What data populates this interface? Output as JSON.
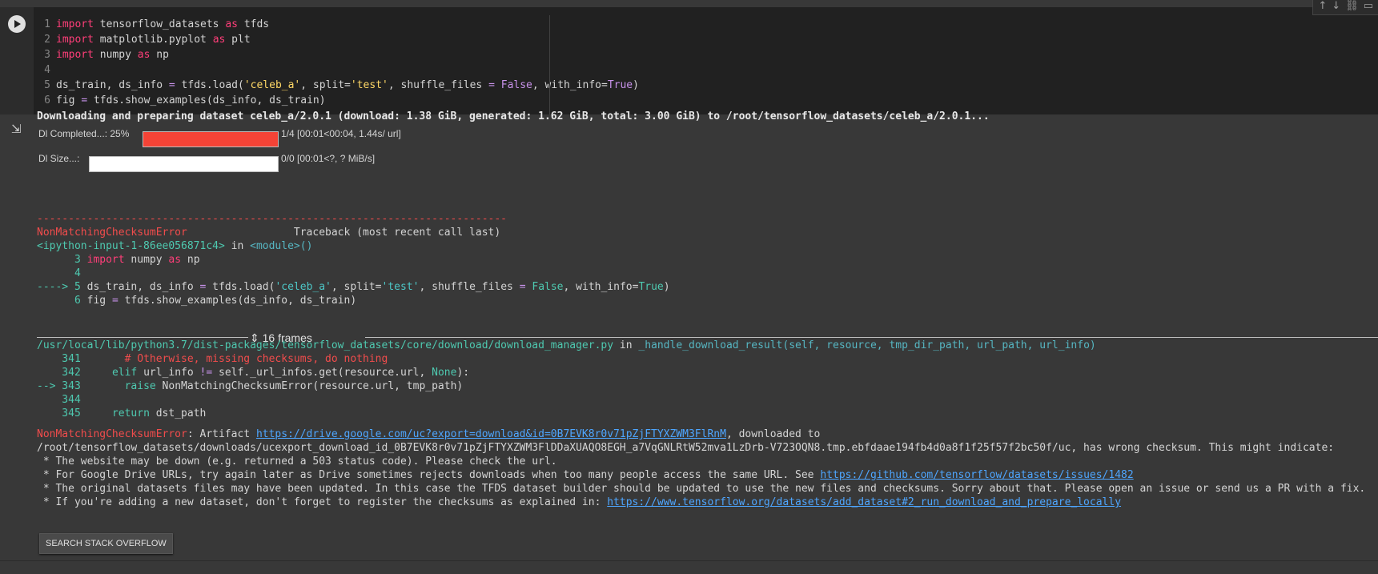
{
  "toolbar": {
    "icons": [
      "arrow-up-icon",
      "arrow-down-icon",
      "link-icon",
      "comment-icon"
    ]
  },
  "code": {
    "lines": [
      {
        "n": "1",
        "parts": [
          {
            "t": "import",
            "c": "kw"
          },
          {
            "t": " tensorflow_datasets ",
            "c": ""
          },
          {
            "t": "as",
            "c": "kw"
          },
          {
            "t": " tfds",
            "c": ""
          }
        ]
      },
      {
        "n": "2",
        "parts": [
          {
            "t": "import",
            "c": "kw"
          },
          {
            "t": " matplotlib.pyplot ",
            "c": ""
          },
          {
            "t": "as",
            "c": "kw"
          },
          {
            "t": " plt",
            "c": ""
          }
        ]
      },
      {
        "n": "3",
        "parts": [
          {
            "t": "import",
            "c": "kw"
          },
          {
            "t": " numpy ",
            "c": ""
          },
          {
            "t": "as",
            "c": "kw"
          },
          {
            "t": " np",
            "c": ""
          }
        ]
      },
      {
        "n": "4",
        "parts": []
      },
      {
        "n": "5",
        "parts": [
          {
            "t": "ds_train, ds_info ",
            "c": ""
          },
          {
            "t": "=",
            "c": "op"
          },
          {
            "t": " tfds.load(",
            "c": ""
          },
          {
            "t": "'celeb_a'",
            "c": "str"
          },
          {
            "t": ", split=",
            "c": ""
          },
          {
            "t": "'test'",
            "c": "str"
          },
          {
            "t": ", shuffle_files ",
            "c": ""
          },
          {
            "t": "=",
            "c": "op"
          },
          {
            "t": " ",
            "c": ""
          },
          {
            "t": "False",
            "c": "bool"
          },
          {
            "t": ", with_info=",
            "c": ""
          },
          {
            "t": "True",
            "c": "bool"
          },
          {
            "t": ")",
            "c": ""
          }
        ]
      },
      {
        "n": "6",
        "parts": [
          {
            "t": "fig ",
            "c": ""
          },
          {
            "t": "=",
            "c": "op"
          },
          {
            "t": " tfds.show_examples(ds_info, ds_train)",
            "c": ""
          }
        ]
      }
    ]
  },
  "output": {
    "header": "Downloading and preparing dataset celeb_a/2.0.1 (download: 1.38 GiB, generated: 1.62 GiB, total: 3.00 GiB) to /root/tensorflow_datasets/celeb_a/2.0.1...",
    "dl_completed": {
      "label": "Dl Completed...: 25%",
      "progress": 1.0,
      "status": "1/4 [00:01<00:04,  1.44s/ url]"
    },
    "dl_size": {
      "label": "Dl Size...:",
      "progress": 0.0,
      "status": "0/0 [00:01<?, ? MiB/s]"
    },
    "dashes": "---------------------------------------------------------------------------",
    "error_name": "NonMatchingChecksumError",
    "traceback_label": "                 Traceback (most recent call last)",
    "ipython_input": "<ipython-input-1-86ee056871c4>",
    "in_word": " in ",
    "module": "<module>()",
    "tb1": [
      {
        "prefix": "      3 ",
        "parts": [
          {
            "t": "import",
            "c": "kw"
          },
          {
            "t": " numpy ",
            "c": ""
          },
          {
            "t": "as",
            "c": "kw"
          },
          {
            "t": " np",
            "c": ""
          }
        ]
      },
      {
        "prefix": "      4 ",
        "parts": []
      },
      {
        "prefix": "----> 5 ",
        "arrow": true,
        "parts": [
          {
            "t": "ds_train, ds_info ",
            "c": ""
          },
          {
            "t": "=",
            "c": "op"
          },
          {
            "t": " tfds.load(",
            "c": ""
          },
          {
            "t": "'celeb_a'",
            "c": "teal"
          },
          {
            "t": ", split=",
            "c": ""
          },
          {
            "t": "'test'",
            "c": "teal"
          },
          {
            "t": ", shuffle_files ",
            "c": ""
          },
          {
            "t": "=",
            "c": "op"
          },
          {
            "t": " ",
            "c": ""
          },
          {
            "t": "False",
            "c": "green"
          },
          {
            "t": ", with_info=",
            "c": ""
          },
          {
            "t": "True",
            "c": "green"
          },
          {
            "t": ")",
            "c": ""
          }
        ]
      },
      {
        "prefix": "      6 ",
        "parts": [
          {
            "t": "fig ",
            "c": ""
          },
          {
            "t": "=",
            "c": "op"
          },
          {
            "t": " tfds.show_examples(ds_info, ds_train)",
            "c": ""
          }
        ]
      }
    ],
    "frames": "16 frames",
    "file_path": "/usr/local/lib/python3.7/dist-packages/tensorflow_datasets/core/download/download_manager.py",
    "func": "_handle_download_result(self, resource, tmp_dir_path, url_path, url_info)",
    "tb2": [
      {
        "prefix": "    341 ",
        "parts": [
          {
            "t": "      # Otherwise, missing checksums, do nothing",
            "c": "red"
          }
        ]
      },
      {
        "prefix": "    342 ",
        "parts": [
          {
            "t": "    ",
            "c": ""
          },
          {
            "t": "elif",
            "c": "green"
          },
          {
            "t": " url_info ",
            "c": ""
          },
          {
            "t": "!=",
            "c": "op"
          },
          {
            "t": " self._url_infos.get(resource.url, ",
            "c": ""
          },
          {
            "t": "None",
            "c": "green"
          },
          {
            "t": "):",
            "c": ""
          }
        ]
      },
      {
        "prefix": "--> 343 ",
        "arrow": true,
        "parts": [
          {
            "t": "      ",
            "c": ""
          },
          {
            "t": "raise",
            "c": "green"
          },
          {
            "t": " NonMatchingChecksumError(resource.url, tmp_path)",
            "c": ""
          }
        ]
      },
      {
        "prefix": "    344 ",
        "parts": []
      },
      {
        "prefix": "    345 ",
        "parts": [
          {
            "t": "    ",
            "c": ""
          },
          {
            "t": "return",
            "c": "green"
          },
          {
            "t": " dst_path",
            "c": ""
          }
        ]
      }
    ],
    "msg_prefix": ": Artifact ",
    "artifact_url": "https://drive.google.com/uc?export=download&id=0B7EVK8r0v71pZjFTYXZWM3FlRnM",
    "msg_suffix": ", downloaded to",
    "msg_line2": "/root/tensorflow_datasets/downloads/ucexport_download_id_0B7EVK8r0v71pZjFTYXZWM3FlDDaXUAQO8EGH_a7VqGNLRtW52mva1LzDrb-V723OQN8.tmp.ebfdaae194fb4d0a8f1f25f57f2bc50f/uc, has wrong checksum. This might indicate:",
    "bullet1": " * The website may be down (e.g. returned a 503 status code). Please check the url.",
    "bullet2_text": " * For Google Drive URLs, try again later as Drive sometimes rejects downloads when too many people access the same URL. See ",
    "bullet2_link": "https://github.com/tensorflow/datasets/issues/1482",
    "bullet3": " * The original datasets files may have been updated. In this case the TFDS dataset builder should be updated to use the new files and checksums. Sorry about that. Please open an issue or send us a PR with a fix.",
    "bullet4_text": " * If you're adding a new dataset, don't forget to register the checksums as explained in: ",
    "bullet4_link": "https://www.tensorflow.org/datasets/add_dataset#2_run_download_and_prepare_locally"
  },
  "search_button": "SEARCH STACK OVERFLOW",
  "colors": {
    "progress_fill": "#f44336",
    "background": "#383838",
    "cell": "#212121"
  }
}
